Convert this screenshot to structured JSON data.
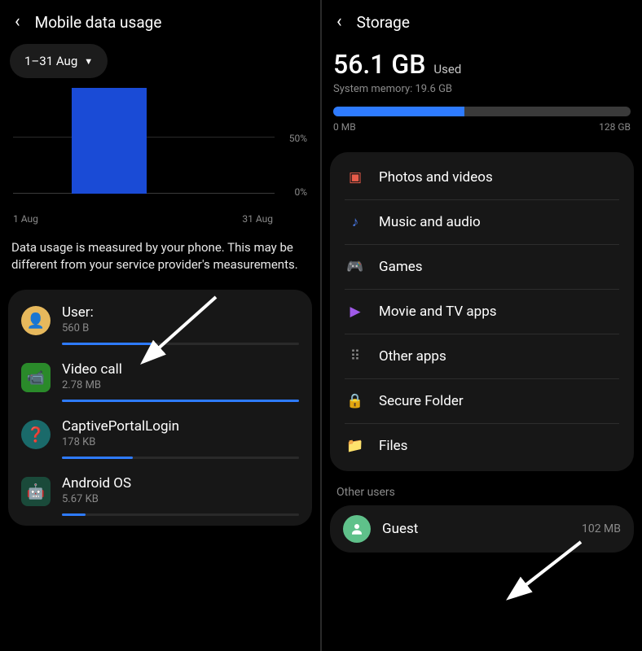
{
  "left": {
    "title": "Mobile data usage",
    "date_range": "1–31 Aug",
    "chart": {
      "y50": "50%",
      "y0": "0%",
      "x_start": "1 Aug",
      "x_end": "31 Aug"
    },
    "note": "Data usage is measured by your phone. This may be different from your service provider's measurements.",
    "apps": [
      {
        "name": "User:",
        "size": "560 B",
        "fill": 38,
        "icon_bg": "#e6b85c",
        "glyph": "👤",
        "shape": "round"
      },
      {
        "name": "Video call",
        "size": "2.78 MB",
        "fill": 100,
        "icon_bg": "#2a8a2a",
        "glyph": "📹",
        "shape": "square"
      },
      {
        "name": "CaptivePortalLogin",
        "size": "178 KB",
        "fill": 30,
        "icon_bg": "#1a6a6a",
        "glyph": "❓",
        "shape": "round"
      },
      {
        "name": "Android OS",
        "size": "5.67 KB",
        "fill": 10,
        "icon_bg": "#1a4a3a",
        "glyph": "🤖",
        "shape": "square"
      }
    ]
  },
  "right": {
    "title": "Storage",
    "used_value": "56.1 GB",
    "used_label": "Used",
    "system_memory": "System memory: 19.6 GB",
    "bar_min": "0 MB",
    "bar_max": "128 GB",
    "bar_fill_pct": 44,
    "categories": [
      {
        "label": "Photos and videos",
        "color": "#e85c4a",
        "glyph": "▣"
      },
      {
        "label": "Music and audio",
        "color": "#4a7ae8",
        "glyph": "♪"
      },
      {
        "label": "Games",
        "color": "#2ab8a0",
        "glyph": "🎮"
      },
      {
        "label": "Movie and TV apps",
        "color": "#a05ae8",
        "glyph": "▶"
      },
      {
        "label": "Other apps",
        "color": "#8a8a8a",
        "glyph": "⠿"
      },
      {
        "label": "Secure Folder",
        "color": "#4a6ae8",
        "glyph": "🔒"
      },
      {
        "label": "Files",
        "color": "#e8a84a",
        "glyph": "📁"
      }
    ],
    "other_users_header": "Other users",
    "guest": {
      "label": "Guest",
      "size": "102 MB"
    }
  },
  "chart_data": {
    "type": "bar",
    "title": "Mobile data usage",
    "xlabel": "",
    "ylabel": "",
    "x_range": [
      "1 Aug",
      "31 Aug"
    ],
    "y_ticks_pct": [
      0,
      50
    ],
    "series": [
      {
        "name": "usage",
        "approx_peak_pct": 85,
        "note": "single blue bar near start of month reaching ~85% of chart height"
      }
    ]
  }
}
